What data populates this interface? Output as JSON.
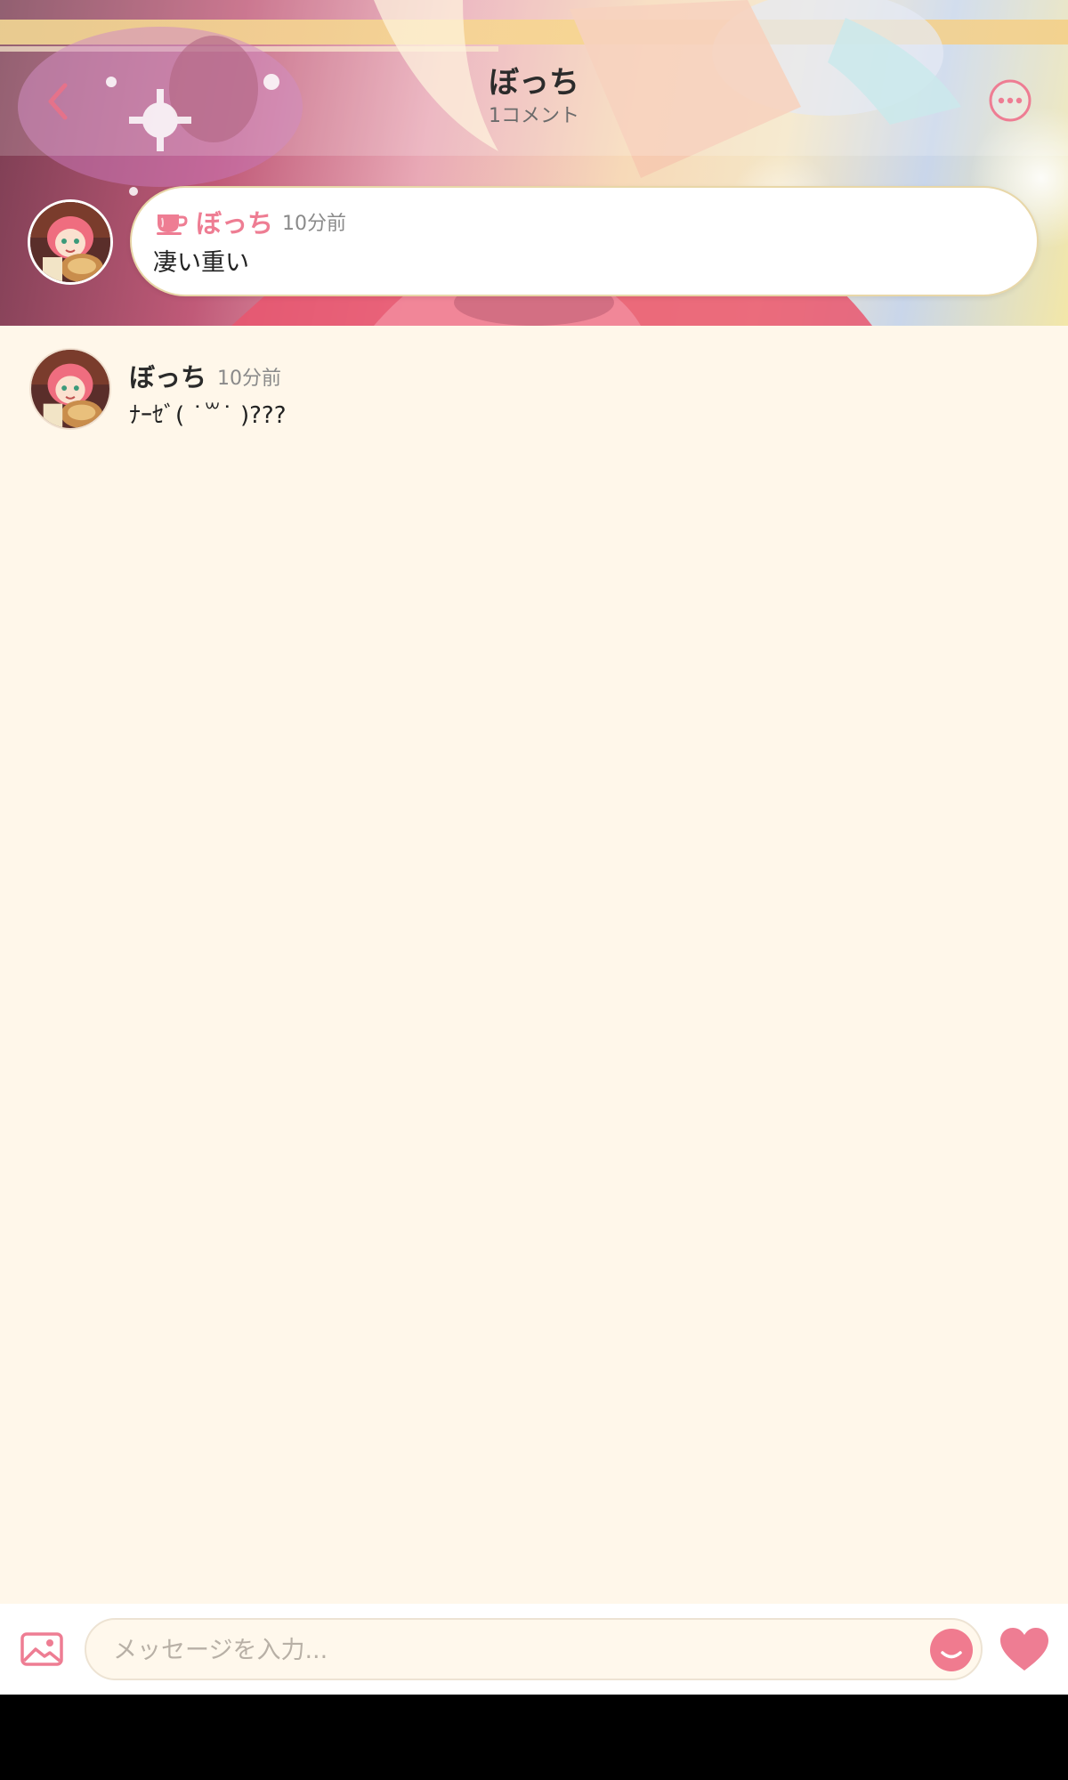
{
  "header": {
    "title": "ぼっち",
    "subtitle": "1コメント",
    "back_icon": "chevron-left-icon",
    "more_icon": "more-horizontal-icon"
  },
  "pinned_comment": {
    "icon": "cup-icon",
    "name": "ぼっち",
    "time": "10分前",
    "text": "凄い重い"
  },
  "comments": [
    {
      "name": "ぼっち",
      "time": "10分前",
      "text": "ﾅｰｾﾞ( ˙꒳​˙ )???"
    }
  ],
  "composer": {
    "placeholder": "メッセージを入力...",
    "image_icon": "image-icon",
    "emoji_icon": "emoji-icon",
    "like_icon": "heart-icon"
  },
  "colors": {
    "accent": "#ee7d93",
    "background": "#fff7ea",
    "bar": "#ffffff"
  }
}
